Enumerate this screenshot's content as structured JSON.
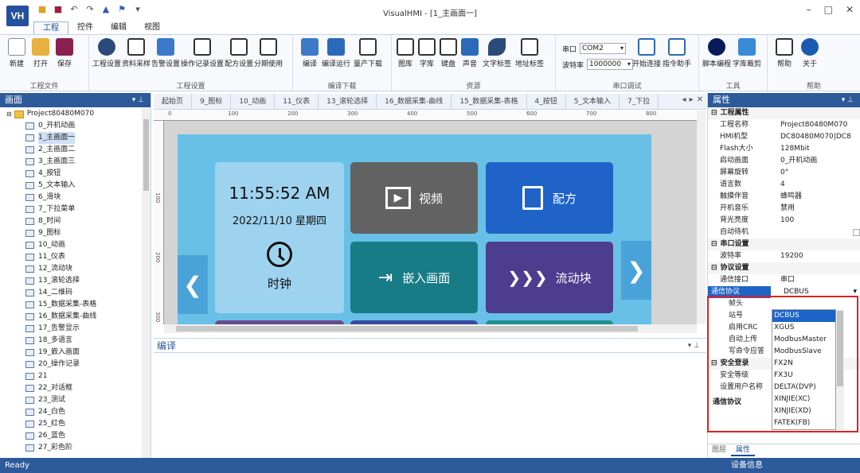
{
  "window": {
    "title": "VisualHMI - [1_主画面一]",
    "logo": "VH"
  },
  "ribbon_tabs": [
    "工程",
    "控件",
    "编辑",
    "视图"
  ],
  "groups": {
    "file": {
      "label": "工程文件",
      "buttons": [
        "新建",
        "打开",
        "保存"
      ]
    },
    "project": {
      "label": "工程设置",
      "buttons": [
        "工程设置",
        "资料采样",
        "告警设置",
        "操作记录设置",
        "配方设置",
        "分期使用"
      ]
    },
    "compile": {
      "label": "编译下载",
      "buttons": [
        "编译",
        "编译运行",
        "量产下载"
      ]
    },
    "resource": {
      "label": "资源",
      "buttons": [
        "图库",
        "字库",
        "键盘",
        "声音",
        "文字标签",
        "地址标签"
      ]
    },
    "serial": {
      "label": "串口调试",
      "port_label": "串口",
      "port_value": "COM2",
      "baud_label": "波特率",
      "baud_value": "1000000",
      "buttons": [
        "开始连接",
        "指令助手"
      ]
    },
    "tools": {
      "label": "工具",
      "buttons": [
        "脚本编程",
        "字库裁剪"
      ]
    },
    "help": {
      "label": "帮助",
      "buttons": [
        "帮助",
        "关于"
      ]
    }
  },
  "left_panel": {
    "title": "画面",
    "root": "Project80480M070",
    "items": [
      "0_开机动画",
      "1_主画面一",
      "2_主画面二",
      "3_主画面三",
      "4_按钮",
      "5_文本输入",
      "6_滑块",
      "7_下拉菜单",
      "8_时间",
      "9_图标",
      "10_动画",
      "11_仪表",
      "12_流动块",
      "13_滚轮选择",
      "14_二维码",
      "15_数据采集-表格",
      "16_数据采集-曲线",
      "17_告警显示",
      "18_多语言",
      "19_嵌入画面",
      "20_操作记录",
      "21",
      "22_对话框",
      "23_测试",
      "24_白色",
      "25_红色",
      "26_蓝色",
      "27_彩色阶"
    ]
  },
  "doc_tabs": [
    "起始页",
    "9_图标",
    "10_动画",
    "11_仪表",
    "13_滚轮选择",
    "16_数据采集-曲线",
    "15_数据采集-表格",
    "4_按钮",
    "5_文本输入",
    "7_下拉"
  ],
  "ruler": [
    "0",
    "100",
    "200",
    "300",
    "400",
    "500",
    "600",
    "700",
    "800"
  ],
  "vruler": [
    "100",
    "200",
    "300"
  ],
  "hmi": {
    "clock_time": "11:55:52 AM",
    "clock_date": "2022/11/10 星期四",
    "clock_label": "时钟",
    "video": "视频",
    "recipe": "配方",
    "embed": "嵌入画面",
    "flow": "流动块"
  },
  "compile_panel": {
    "title": "编译"
  },
  "properties": {
    "title": "属性",
    "cat_project": "工程属性",
    "project": [
      [
        "工程名称",
        "Project80480M070"
      ],
      [
        "HMI机型",
        "DC80480M070|DC8"
      ],
      [
        "Flash大小",
        "128Mbit"
      ],
      [
        "启动画面",
        "0_开机动画"
      ],
      [
        "屏幕旋转",
        "0°"
      ],
      [
        "语言数",
        "4"
      ],
      [
        "触摸伴音",
        "蜂鸣器"
      ],
      [
        "开机音乐",
        "禁用"
      ],
      [
        "背光亮度",
        "100"
      ],
      [
        "自动待机",
        ""
      ]
    ],
    "cat_serial": "串口设置",
    "serial": [
      [
        "波特率",
        "19200"
      ]
    ],
    "cat_protocol": "协议设置",
    "protocol": [
      [
        "通信接口",
        "串口"
      ]
    ],
    "protocol_sel": [
      "通信协议",
      "DCBUS"
    ],
    "protocol_more": [
      "帧头",
      "站号",
      "启用CRC",
      "自动上传",
      "写命令应答"
    ],
    "cat_security": "安全登录",
    "security": [
      "安全等级",
      "设置用户名称"
    ],
    "desc": "通信协议"
  },
  "dropdown": [
    "DCBUS",
    "XGUS",
    "ModbusMaster",
    "ModbusSlave",
    "FX2N",
    "FX3U",
    "DELTA(DVP)",
    "XINJIE(XC)",
    "XINJIE(XD)",
    "FATEK(FB)"
  ],
  "right_tabs": [
    "图层",
    "属性"
  ],
  "status": {
    "left": "Ready",
    "right": "设备信息"
  }
}
